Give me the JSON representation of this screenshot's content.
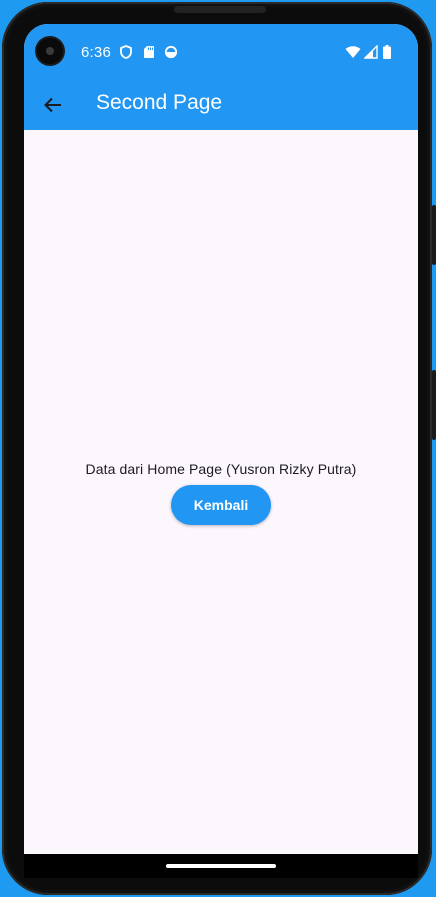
{
  "status_bar": {
    "time": "6:36",
    "left_icons": [
      "shield-icon",
      "sd-card-icon",
      "sync-icon"
    ],
    "right_icons": [
      "wifi-icon",
      "cell-signal-icon",
      "battery-icon"
    ]
  },
  "app_bar": {
    "back_icon": "arrow-back-icon",
    "title": "Second Page",
    "color": "#2196f3"
  },
  "content": {
    "message": "Data dari Home Page (Yusron Rizky Putra)",
    "button_label": "Kembali"
  },
  "colors": {
    "accent": "#2196f3",
    "background": "#fcf6fd",
    "outer_background": "#1e9bf0"
  }
}
